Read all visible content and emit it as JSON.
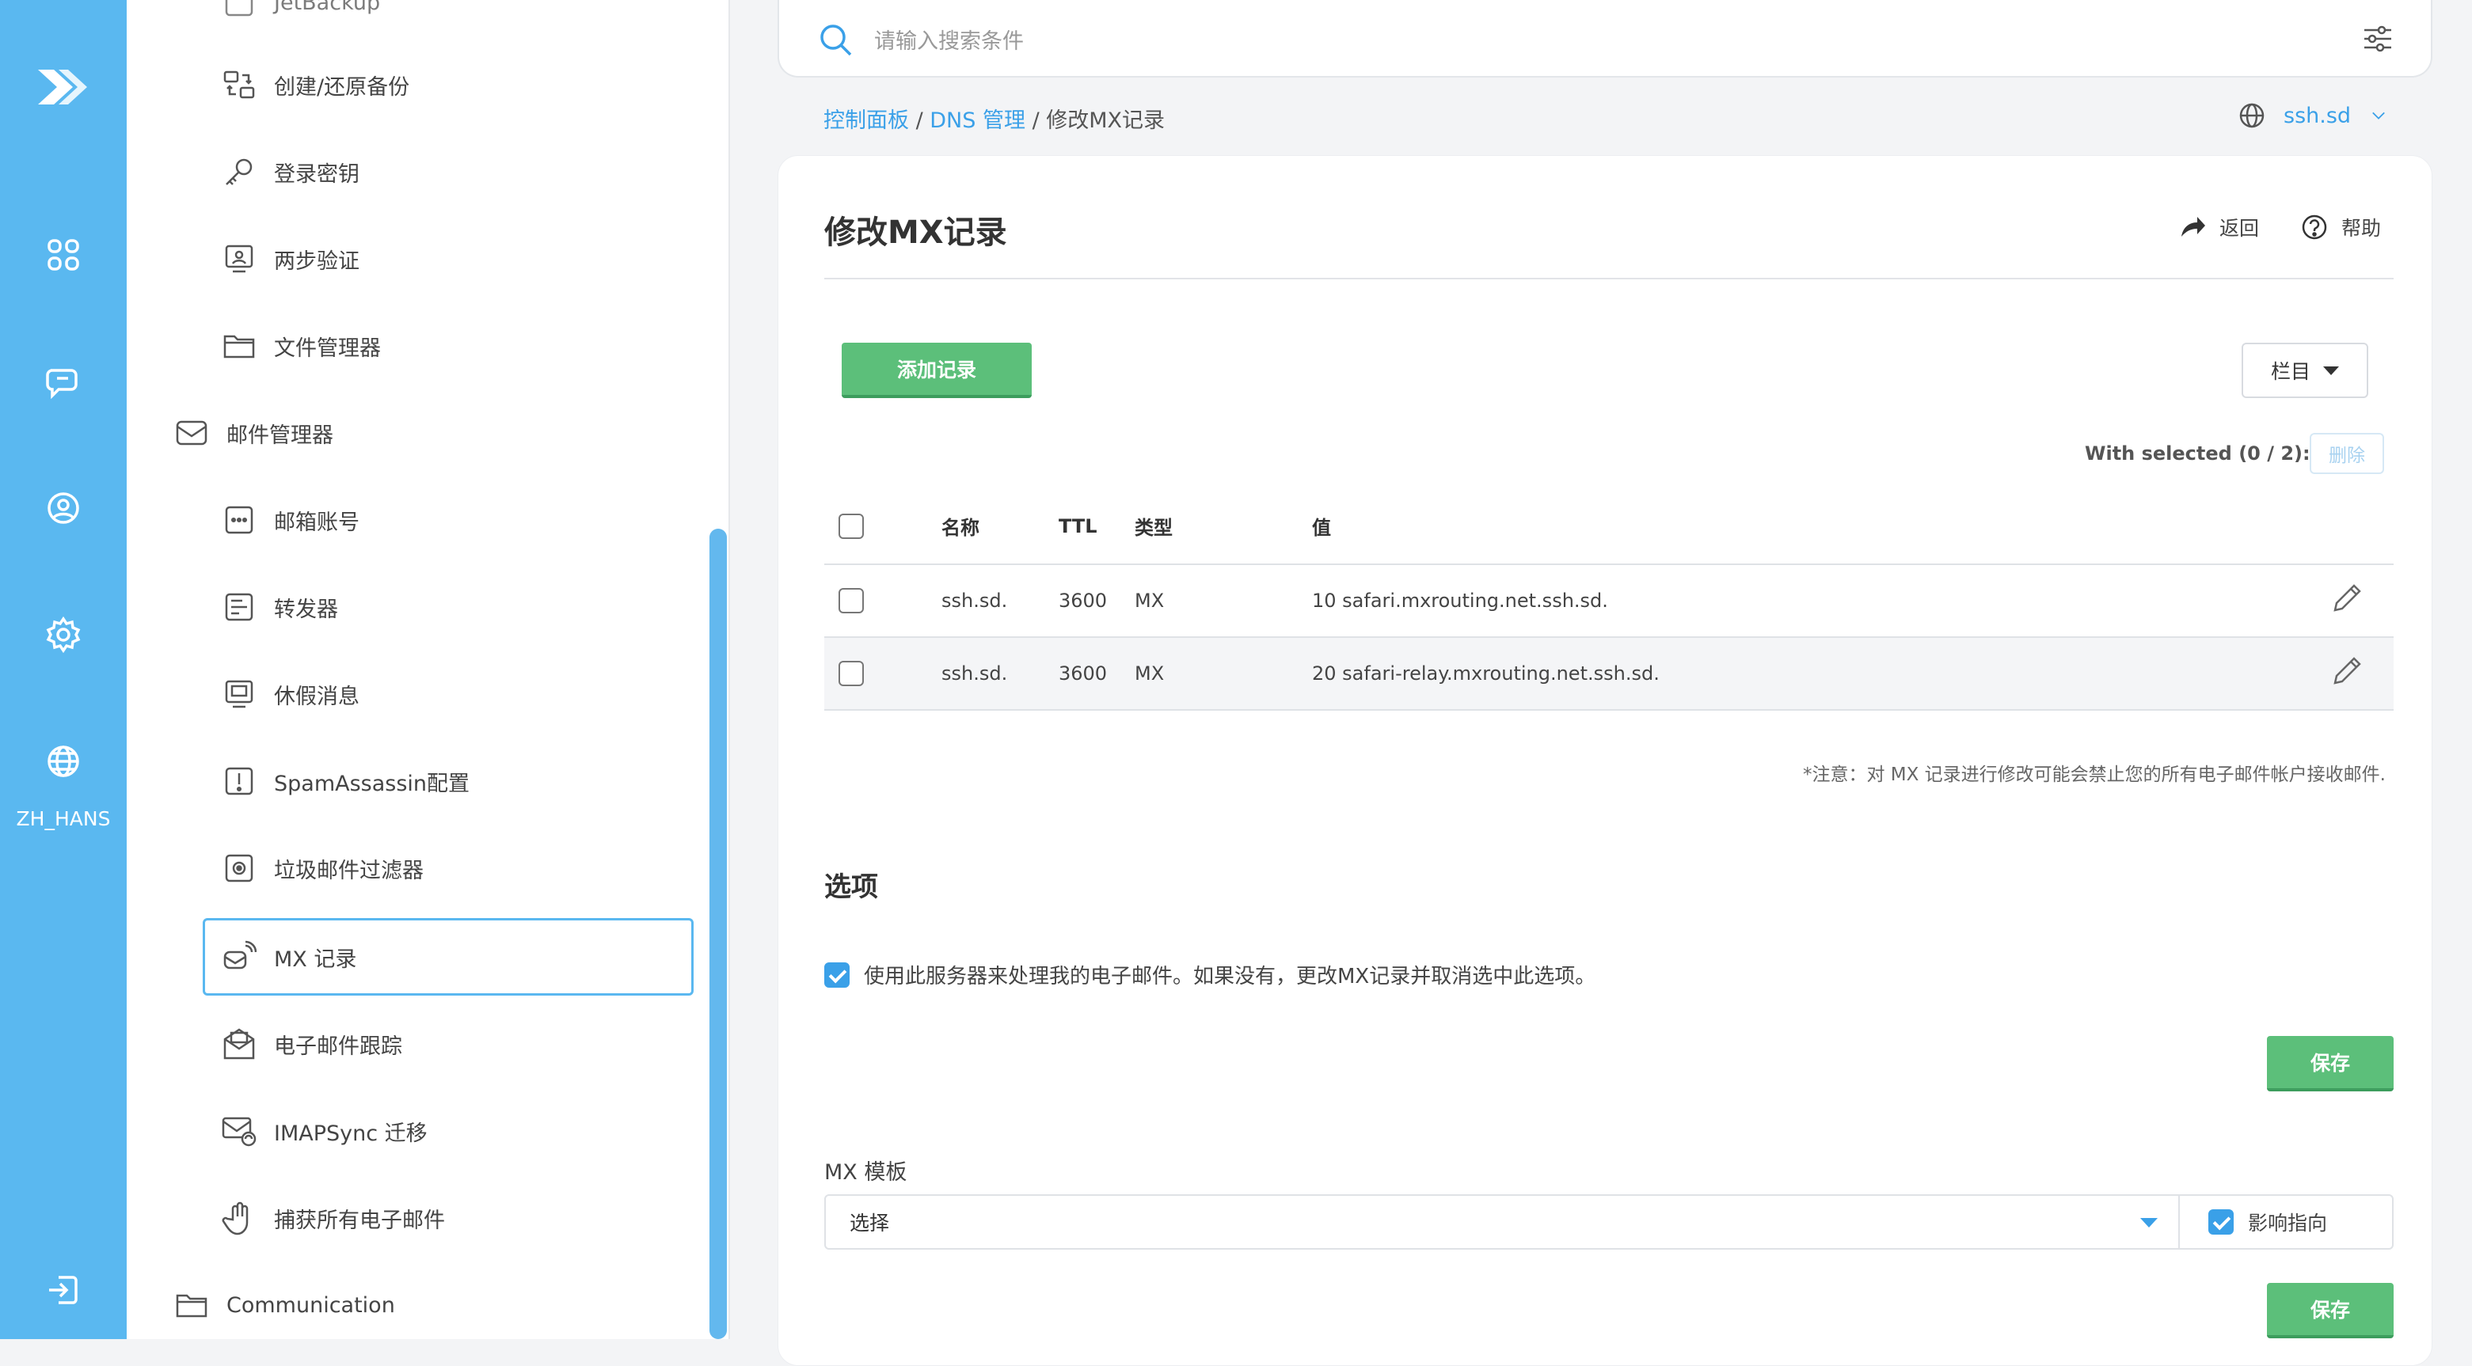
{
  "rail": {
    "icons": [
      "logo-icon",
      "dashboard-icon",
      "chat-icon",
      "user-icon",
      "settings-icon",
      "globe-icon",
      "logout-icon"
    ],
    "lang_label": "ZH_HANS",
    "accent": "#5ab8f0"
  },
  "sidebar": {
    "partial_top": "JetBackup",
    "items": [
      {
        "label": "创建/还原备份",
        "icon": "backup-restore-icon"
      },
      {
        "label": "登录密钥",
        "icon": "key-icon"
      },
      {
        "label": "两步验证",
        "icon": "two-factor-icon"
      },
      {
        "label": "文件管理器",
        "icon": "folder-icon"
      }
    ],
    "mail_group": {
      "label": "邮件管理器",
      "icon": "mail-icon",
      "expanded": true
    },
    "mail_items": [
      {
        "label": "邮箱账号",
        "icon": "mailbox-icon"
      },
      {
        "label": "转发器",
        "icon": "forwarder-icon"
      },
      {
        "label": "休假消息",
        "icon": "vacation-icon"
      },
      {
        "label": "SpamAssassin配置",
        "icon": "alert-icon"
      },
      {
        "label": "垃圾邮件过滤器",
        "icon": "spam-filter-icon"
      },
      {
        "label": "MX 记录",
        "icon": "mx-record-icon",
        "active": true
      },
      {
        "label": "电子邮件跟踪",
        "icon": "email-track-icon"
      },
      {
        "label": "IMAPSync 迁移",
        "icon": "imapsync-icon"
      },
      {
        "label": "捕获所有电子邮件",
        "icon": "hand-icon"
      }
    ],
    "comm_group": {
      "label": "Communication",
      "icon": "folder-icon",
      "expanded": false
    }
  },
  "search": {
    "placeholder": "请输入搜索条件"
  },
  "breadcrumb": {
    "home": "控制面板",
    "sep": " / ",
    "dns": "DNS 管理",
    "current": "修改MX记录"
  },
  "domain_selector": {
    "value": "ssh.sd"
  },
  "page": {
    "title": "修改MX记录",
    "back_label": "返回",
    "help_label": "帮助",
    "add_record": "添加记录",
    "columns_btn": "栏目",
    "with_selected": "With selected (0 / 2):",
    "delete_btn": "删除"
  },
  "table": {
    "headers": {
      "name": "名称",
      "ttl": "TTL",
      "type": "类型",
      "value": "值"
    },
    "rows": [
      {
        "name": "ssh.sd.",
        "ttl": "3600",
        "type": "MX",
        "value": "10 safari.mxrouting.net.ssh.sd."
      },
      {
        "name": "ssh.sd.",
        "ttl": "3600",
        "type": "MX",
        "value": "20 safari-relay.mxrouting.net.ssh.sd."
      }
    ]
  },
  "note": "*注意：对 MX 记录进行修改可能会禁止您的所有电子邮件帐户接收邮件.",
  "options": {
    "title": "选项",
    "checkbox_label": "使用此服务器来处理我的电子邮件。如果没有，更改MX记录并取消选中此选项。",
    "checked": true,
    "save": "保存"
  },
  "mx_template": {
    "label": "MX 模板",
    "select_value": "选择",
    "affect_label": "影响指向",
    "affect_checked": true,
    "save": "保存"
  },
  "colors": {
    "accent": "#3aa0e8",
    "green": "#5cbf7a"
  }
}
